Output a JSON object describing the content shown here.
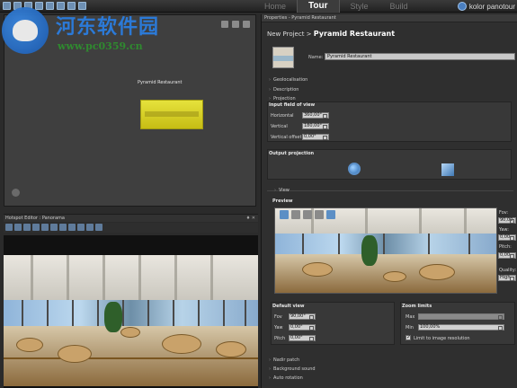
{
  "topbar": {
    "tabs": [
      {
        "label": "Home",
        "active": false
      },
      {
        "label": "Tour",
        "active": true
      },
      {
        "label": "Style",
        "active": false
      },
      {
        "label": "Build",
        "active": false
      }
    ],
    "brand": "kolor panotour"
  },
  "project_map": {
    "node_label": "Pyramid Restaurant"
  },
  "watermark": {
    "title": "河东软件园",
    "url": "www.pc0359.cn"
  },
  "hotspot_editor": {
    "title": "Hotspot Editor : Panorama",
    "controls": "♦ ✕"
  },
  "properties": {
    "header": "Properties - Pyramid Restaurant",
    "breadcrumb_prefix": "New Project > ",
    "breadcrumb_title": "Pyramid Restaurant",
    "name_label": "Name:",
    "name_value": "Pyramid Restaurant",
    "sections": {
      "geolocalisation": "Geolocalisation",
      "description": "Description",
      "projection": "Projection",
      "view": "View",
      "nadir_patch": "Nadir patch",
      "background_sound": "Background sound",
      "auto_rotation": "Auto rotation"
    },
    "input_fov": {
      "title": "Input field of view",
      "horizontal_label": "Horizontal",
      "horizontal_value": "360,00°",
      "vertical_label": "Vertical",
      "vertical_value": "180,00°",
      "vertical_offset_label": "Vertical offset",
      "vertical_offset_value": "0,00°"
    },
    "output_projection": {
      "title": "Output projection"
    },
    "preview": {
      "title": "Preview",
      "fov_label": "Fov:",
      "fov_value": "90,00",
      "yaw_label": "Yaw:",
      "yaw_value": "0,00",
      "pitch_label": "Pitch:",
      "pitch_value": "0,00",
      "quality_label": "Quality:",
      "quality_value": "High"
    },
    "default_view": {
      "title": "Default view",
      "fov_label": "Fov",
      "fov_value": "90,00°",
      "yaw_label": "Yaw",
      "yaw_value": "0,00°",
      "pitch_label": "Pitch",
      "pitch_value": "0,00°"
    },
    "zoom_limits": {
      "title": "Zoom limits",
      "max_label": "Max",
      "min_label": "Min",
      "min_value": "100,00%",
      "limit_checkbox_label": "Limit to image resolution",
      "limit_checked": true
    }
  }
}
